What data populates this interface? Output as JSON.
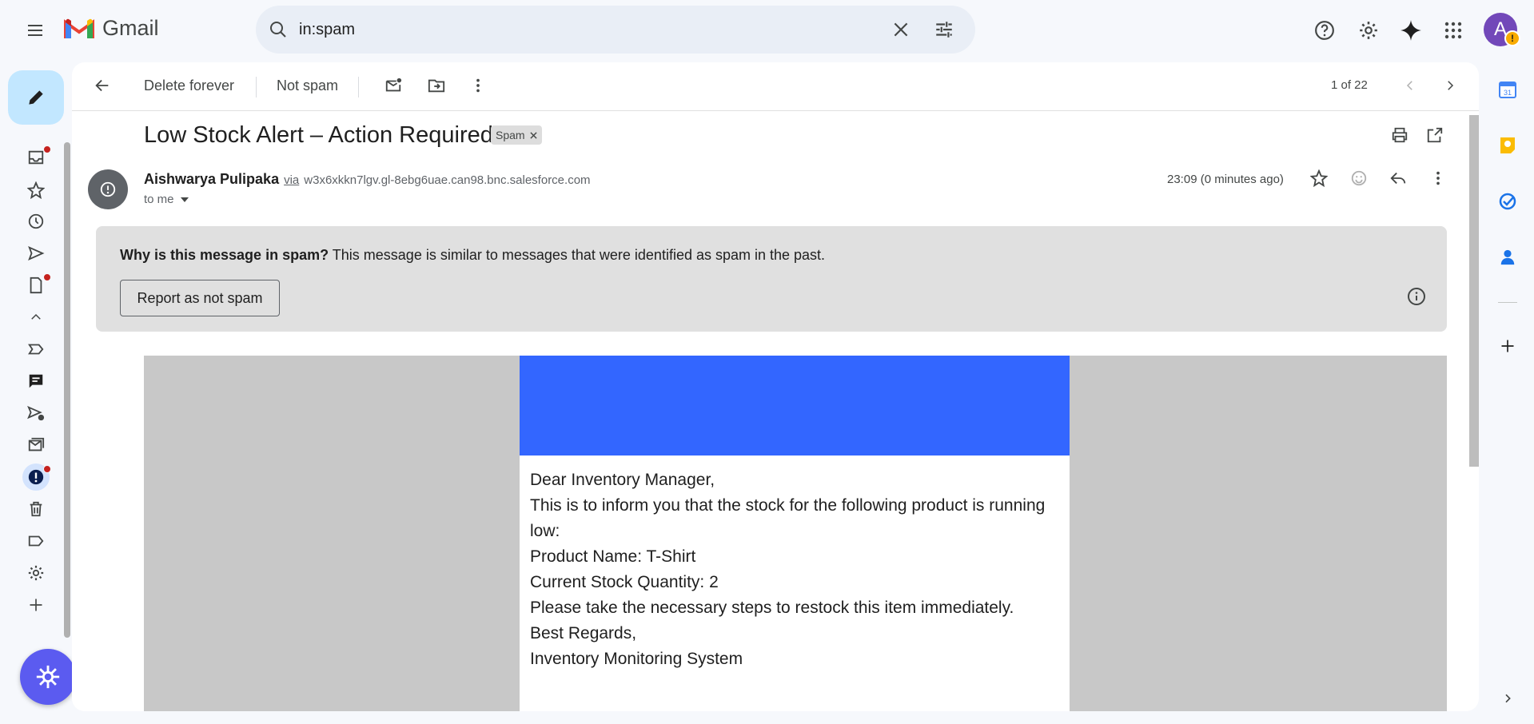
{
  "app": {
    "name": "Gmail"
  },
  "search": {
    "query": "in:spam"
  },
  "toolbar": {
    "delete_forever": "Delete forever",
    "not_spam": "Not spam",
    "pager": "1 of 22"
  },
  "email": {
    "subject": "Low Stock Alert – Action Required",
    "label_chip": "Spam",
    "sender_name": "Aishwarya Pulipaka",
    "via": "via",
    "sender_email": "w3x6xkkn7lgv.gl-8ebg6uae.can98.bnc.salesforce.com",
    "to": "to me",
    "time": "23:09 (0 minutes ago)"
  },
  "spam_notice": {
    "question": "Why is this message in spam?",
    "explanation": "This message is similar to messages that were identified as spam in the past.",
    "report_button": "Report as not spam"
  },
  "body": {
    "greeting": "Dear Inventory Manager,",
    "line1": "This is to inform you that the stock for the following product is running low:",
    "product": "Product Name: T-Shirt",
    "quantity": "Current Stock Quantity: 2",
    "action": "Please take the necessary steps to restock this item immediately.",
    "closing": "Best Regards,",
    "signature": "Inventory Monitoring System"
  },
  "colors": {
    "banner": "#3366ff",
    "compose_bg": "#c2e7ff",
    "warning_bg": "#e0e0e0",
    "avatar": "#7248b9"
  },
  "avatar_initial": "A"
}
